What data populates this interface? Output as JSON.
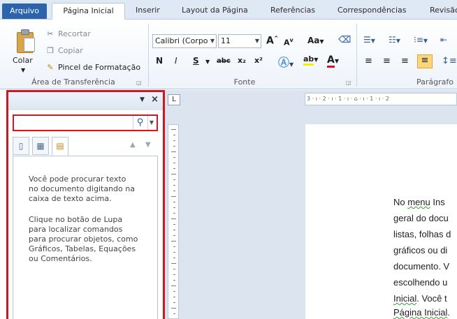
{
  "tabs": {
    "file": "Arquivo",
    "home": "Página Inicial",
    "insert": "Inserir",
    "layout": "Layout da Página",
    "references": "Referências",
    "mailings": "Correspondências",
    "review": "Revisão"
  },
  "clipboard": {
    "paste": "Colar",
    "cut": "Recortar",
    "copy": "Copiar",
    "format_painter": "Pincel de Formatação",
    "group_label": "Área de Transferência"
  },
  "font": {
    "name": "Calibri (Corpo",
    "size": "11",
    "bold": "N",
    "italic": "I",
    "underline": "S",
    "strike": "abc",
    "subscript": "x₂",
    "superscript": "x²",
    "grow": "A",
    "shrink": "A",
    "case": "Aa",
    "color_letter": "A",
    "group_label": "Fonte"
  },
  "paragraph": {
    "group_label": "Parágrafo"
  },
  "nav_pane": {
    "search_value": "",
    "help_text_1": "Você pode procurar texto\nno documento digitando na\ncaixa de texto acima.",
    "help_text_2": "Clique no botão de Lupa\npara localizar comandos\npara procurar objetos, como\nGráficos, Tabelas, Equações\nou Comentários."
  },
  "ruler": {
    "text": "3 · ı · 2 · ı · 1 · ı · ⌂ · ı · 1 · ı · 2"
  },
  "document": {
    "lines": [
      [
        "No ",
        "menu",
        " Ins"
      ],
      [
        "geral do docu",
        "",
        ""
      ],
      [
        "listas, folhas d",
        "",
        ""
      ],
      [
        "gráficos ou di",
        "",
        ""
      ],
      [
        "documento. V",
        "",
        ""
      ],
      [
        "escolhendo u",
        "",
        ""
      ],
      [
        "",
        "Inicial",
        ". Você t"
      ],
      [
        "",
        "Página Inicial",
        "."
      ]
    ]
  },
  "colors": {
    "file_tab": "#2b64ad",
    "highlight_border": "#d4141f",
    "ribbon_bg": "#eef3fa"
  }
}
